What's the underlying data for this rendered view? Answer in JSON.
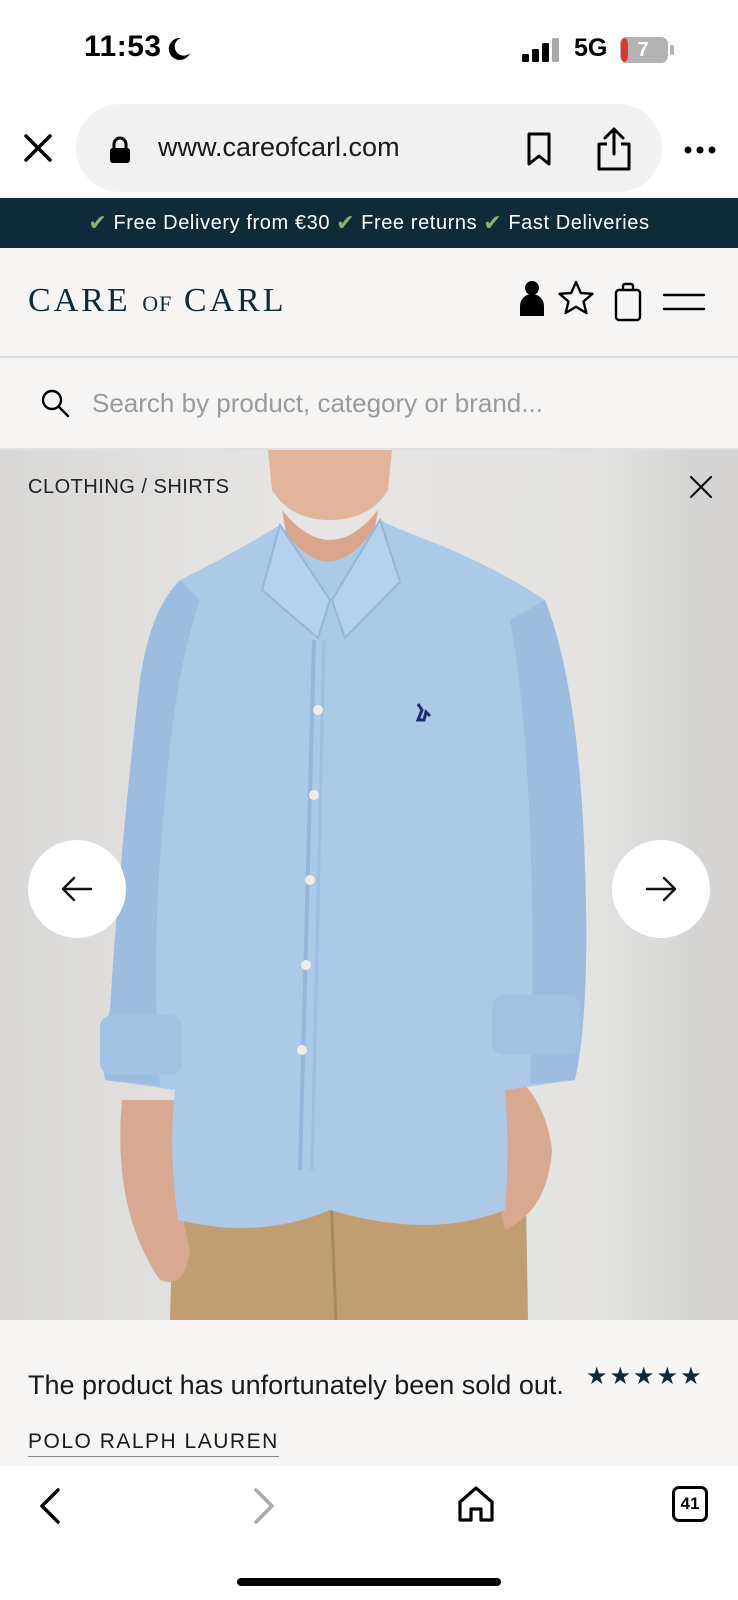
{
  "status_bar": {
    "time": "11:53",
    "network": "5G",
    "battery": "7"
  },
  "browser": {
    "url": "www.careofcarl.com",
    "icons": [
      "close-icon",
      "lock-icon",
      "bookmark-icon",
      "share-icon",
      "more-icon"
    ]
  },
  "promo": {
    "items": [
      "Free Delivery from €30",
      "Free returns",
      "Fast Deliveries"
    ],
    "background": "#0f2a38"
  },
  "header": {
    "logo_part1": "CARE ",
    "logo_part2": "OF",
    "logo_part3": " CARL",
    "icons": [
      "account-icon",
      "star-icon",
      "bag-icon",
      "menu-icon"
    ]
  },
  "search": {
    "placeholder": "Search by product, category or brand..."
  },
  "product": {
    "breadcrumb": "CLOTHING / SHIRTS",
    "sold_out_text": "The product has unfortunately been sold out.",
    "rating_stars": "★★★★★",
    "rating": 5,
    "brand": "POLO RALPH LAUREN",
    "shirt_color": "#acc9e8"
  },
  "bottom_bar": {
    "tabs_count": "41",
    "icons": [
      "back-icon",
      "forward-icon",
      "home-icon",
      "tabs-icon"
    ]
  }
}
